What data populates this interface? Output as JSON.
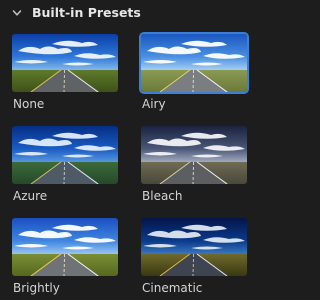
{
  "panel": {
    "title": "Built-in Presets",
    "collapse_icon": "chevron-down-icon"
  },
  "presets": [
    {
      "label": "None",
      "selected": false
    },
    {
      "label": "Airy",
      "selected": true
    },
    {
      "label": "Azure",
      "selected": false
    },
    {
      "label": "Bleach",
      "selected": false
    },
    {
      "label": "Brightly",
      "selected": false
    },
    {
      "label": "Cinematic",
      "selected": false
    }
  ],
  "colors": {
    "background": "#1d1d1d",
    "selected_border": "#3b7fd6",
    "text": "#d4d4d4"
  }
}
